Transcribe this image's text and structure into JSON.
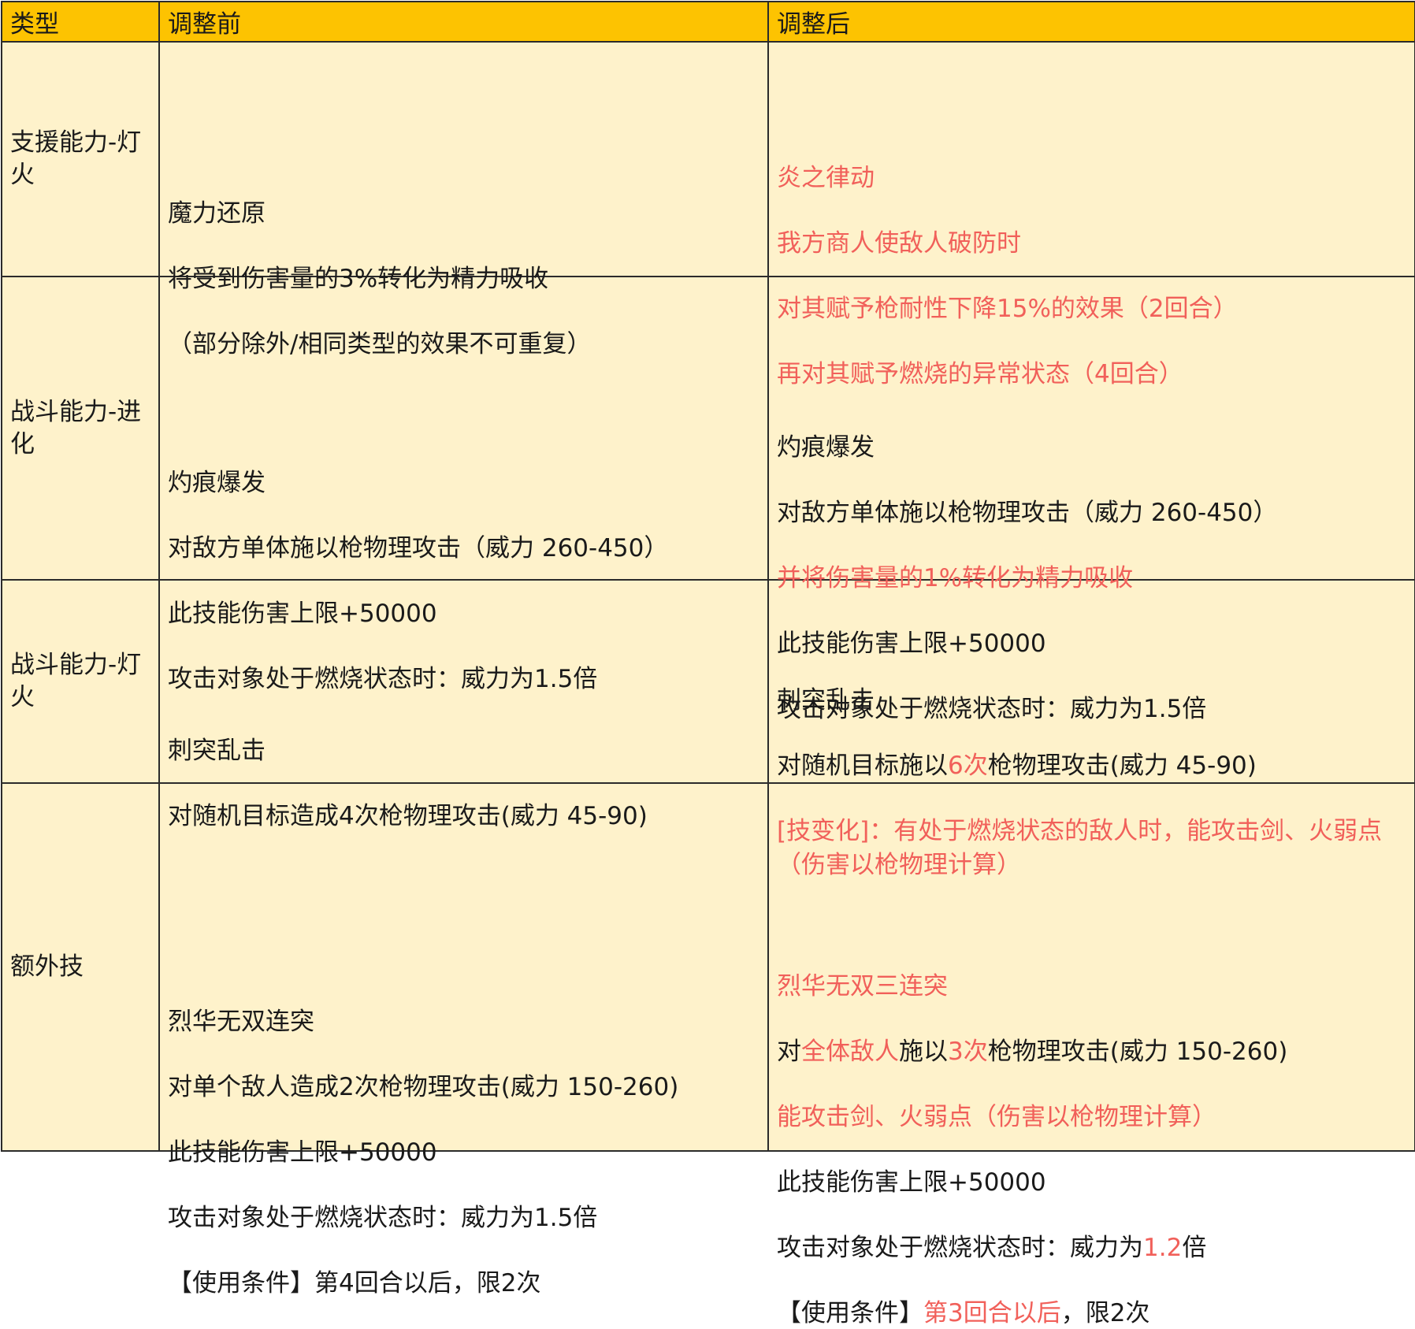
{
  "header": {
    "col_type": "类型",
    "col_before": "调整前",
    "col_after": "调整后"
  },
  "rows": [
    {
      "type": "支援能力-灯火",
      "before": [
        "魔力还原",
        "将受到伤害量的3%转化为精力吸收",
        "（部分除外/相同类型的效果不可重复）"
      ],
      "after": [
        [
          {
            "t": "炎之律动",
            "red": true
          }
        ],
        [
          {
            "t": "我方商人使敌人破防时",
            "red": true
          }
        ],
        [
          {
            "t": "对其赋予枪耐性下降15%的效果（2回合）",
            "red": true
          }
        ],
        [
          {
            "t": "再对其赋予燃烧的异常状态（4回合）",
            "red": true
          }
        ]
      ]
    },
    {
      "type": "战斗能力-进化",
      "before": [
        "灼痕爆发",
        "对敌方单体施以枪物理攻击（威力 260-450）",
        "此技能伤害上限+50000",
        "攻击对象处于燃烧状态时：威力为1.5倍"
      ],
      "after": [
        [
          {
            "t": "灼痕爆发",
            "red": false
          }
        ],
        [
          {
            "t": "对敌方单体施以枪物理攻击（威力 260-450）",
            "red": false
          }
        ],
        [
          {
            "t": "并将伤害量的1%转化为精力吸收",
            "red": true
          }
        ],
        [
          {
            "t": "此技能伤害上限+50000",
            "red": false
          }
        ],
        [
          {
            "t": "攻击对象处于燃烧状态时：威力为1.5倍",
            "red": false
          }
        ]
      ]
    },
    {
      "type": "战斗能力-灯火",
      "before": [
        "刺突乱击",
        "对随机目标造成4次枪物理攻击(威力 45-90)"
      ],
      "after": [
        [
          {
            "t": "刺突乱击",
            "red": false
          }
        ],
        [
          {
            "t": "对随机目标施以",
            "red": false
          },
          {
            "t": "6次",
            "red": true
          },
          {
            "t": "枪物理攻击(威力 45-90)",
            "red": false
          }
        ],
        [
          {
            "t": "[技变化]：有处于燃烧状态的敌人时，能攻击剑、火弱点",
            "red": true
          }
        ],
        [
          {
            "t": "（伤害以枪物理计算）",
            "red": true
          }
        ]
      ]
    },
    {
      "type": "额外技",
      "before": [
        "烈华无双连突",
        "对单个敌人造成2次枪物理攻击(威力 150-260)",
        "此技能伤害上限+50000",
        "攻击对象处于燃烧状态时：威力为1.5倍",
        "【使用条件】第4回合以后，限2次"
      ],
      "after": [
        [
          {
            "t": "烈华无双三连突",
            "red": true
          }
        ],
        [
          {
            "t": "对",
            "red": false
          },
          {
            "t": "全体敌人",
            "red": true
          },
          {
            "t": "施以",
            "red": false
          },
          {
            "t": "3次",
            "red": true
          },
          {
            "t": "枪物理攻击(威力 150-260)",
            "red": false
          }
        ],
        [
          {
            "t": "能攻击剑、火弱点（伤害以枪物理计算）",
            "red": true
          }
        ],
        [
          {
            "t": "此技能伤害上限+50000",
            "red": false
          }
        ],
        [
          {
            "t": "攻击对象处于燃烧状态时：威力为",
            "red": false
          },
          {
            "t": "1.2",
            "red": true
          },
          {
            "t": "倍",
            "red": false
          }
        ],
        [
          {
            "t": "【使用条件】",
            "red": false
          },
          {
            "t": "第3回合以后",
            "red": true
          },
          {
            "t": "，限2次",
            "red": false
          }
        ]
      ]
    }
  ],
  "colors": {
    "header_bg": "#fdc301",
    "cell_bg": "#fef2cb",
    "highlight": "#f1605a"
  }
}
